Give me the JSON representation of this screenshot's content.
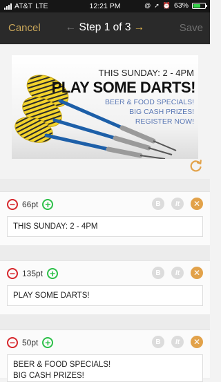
{
  "status_bar": {
    "carrier": "AT&T",
    "network": "LTE",
    "time": "12:21 PM",
    "battery": "63%",
    "battery_level": 0.63,
    "battery_color": "#36d34a"
  },
  "nav": {
    "cancel_label": "Cancel",
    "title": "Step 1 of 3",
    "save_label": "Save",
    "prev_icon": "arrow-left-icon",
    "next_icon": "arrow-right-icon"
  },
  "banner": {
    "line1": "THIS SUNDAY: 2 - 4PM",
    "line2": "PLAY SOME DARTS!",
    "line3": "BEER & FOOD SPECIALS!",
    "line4": "BIG CASH PRIZES!",
    "line5": "REGISTER NOW!"
  },
  "text_blocks": [
    {
      "size": "66pt",
      "text": "THIS SUNDAY: 2 - 4PM"
    },
    {
      "size": "135pt",
      "text": "PLAY SOME DARTS!"
    },
    {
      "size": "50pt",
      "text": "BEER & FOOD SPECIALS!\nBIG CASH PRIZES!\nREGISTER NOW!"
    }
  ],
  "tools": {
    "bold": "B",
    "italic": "It",
    "remove": "✕"
  },
  "colors": {
    "accent": "#e7b94f",
    "minus": "#d6252a",
    "plus": "#2bbf47",
    "remove": "#e2a24a"
  }
}
